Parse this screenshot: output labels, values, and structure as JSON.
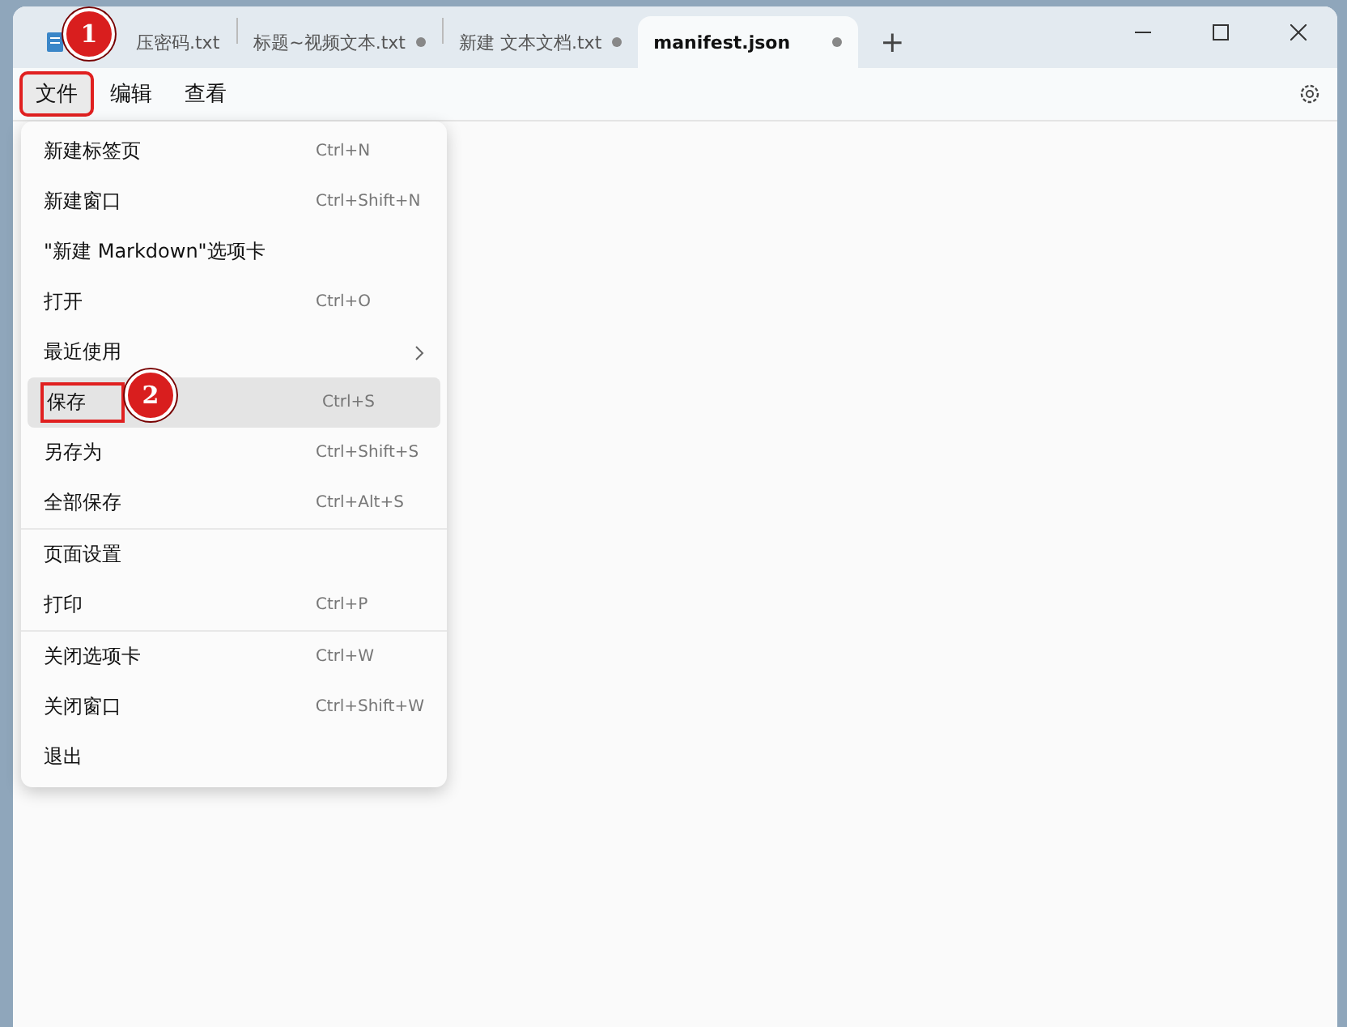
{
  "tabs": [
    {
      "label": "压密码.txt",
      "selected": false,
      "modified": false
    },
    {
      "label": "标题~视频文本.txt",
      "selected": false,
      "modified": true
    },
    {
      "label": "新建 文本文档.txt",
      "selected": false,
      "modified": true
    },
    {
      "label": "manifest.json",
      "selected": true,
      "modified": true
    }
  ],
  "new_tab": "+",
  "menubar": [
    {
      "label": "文件",
      "selected": true,
      "annotation": "1"
    },
    {
      "label": "编辑",
      "selected": false
    },
    {
      "label": "查看",
      "selected": false
    }
  ],
  "menu": {
    "groups": [
      [
        {
          "label": "新建标签页",
          "shortcut": "Ctrl+N",
          "kind": "item",
          "hovered": false
        },
        {
          "label": "新建窗口",
          "shortcut": "Ctrl+Shift+N",
          "kind": "item",
          "hovered": false
        },
        {
          "label": "\"新建 Markdown\"选项卡",
          "kind": "item",
          "hovered": false
        },
        {
          "label": "打开",
          "shortcut": "Ctrl+O",
          "kind": "item",
          "hovered": false
        },
        {
          "label": "最近使用",
          "kind": "submenu",
          "hovered": false
        },
        {
          "label": "保存",
          "shortcut": "Ctrl+S",
          "kind": "item",
          "hovered": true,
          "annotation": "2"
        },
        {
          "label": "另存为",
          "shortcut": "Ctrl+Shift+S",
          "kind": "item",
          "hovered": false
        },
        {
          "label": "全部保存",
          "shortcut": "Ctrl+Alt+S",
          "kind": "item",
          "hovered": false
        }
      ],
      [
        {
          "label": "页面设置",
          "kind": "item",
          "hovered": false
        },
        {
          "label": "打印",
          "shortcut": "Ctrl+P",
          "kind": "item",
          "hovered": false
        }
      ],
      [
        {
          "label": "关闭选项卡",
          "shortcut": "Ctrl+W",
          "kind": "item",
          "hovered": false
        },
        {
          "label": "关闭窗口",
          "shortcut": "Ctrl+Shift+W",
          "kind": "item",
          "hovered": false
        },
        {
          "label": "退出",
          "kind": "item",
          "hovered": false
        }
      ]
    ]
  }
}
